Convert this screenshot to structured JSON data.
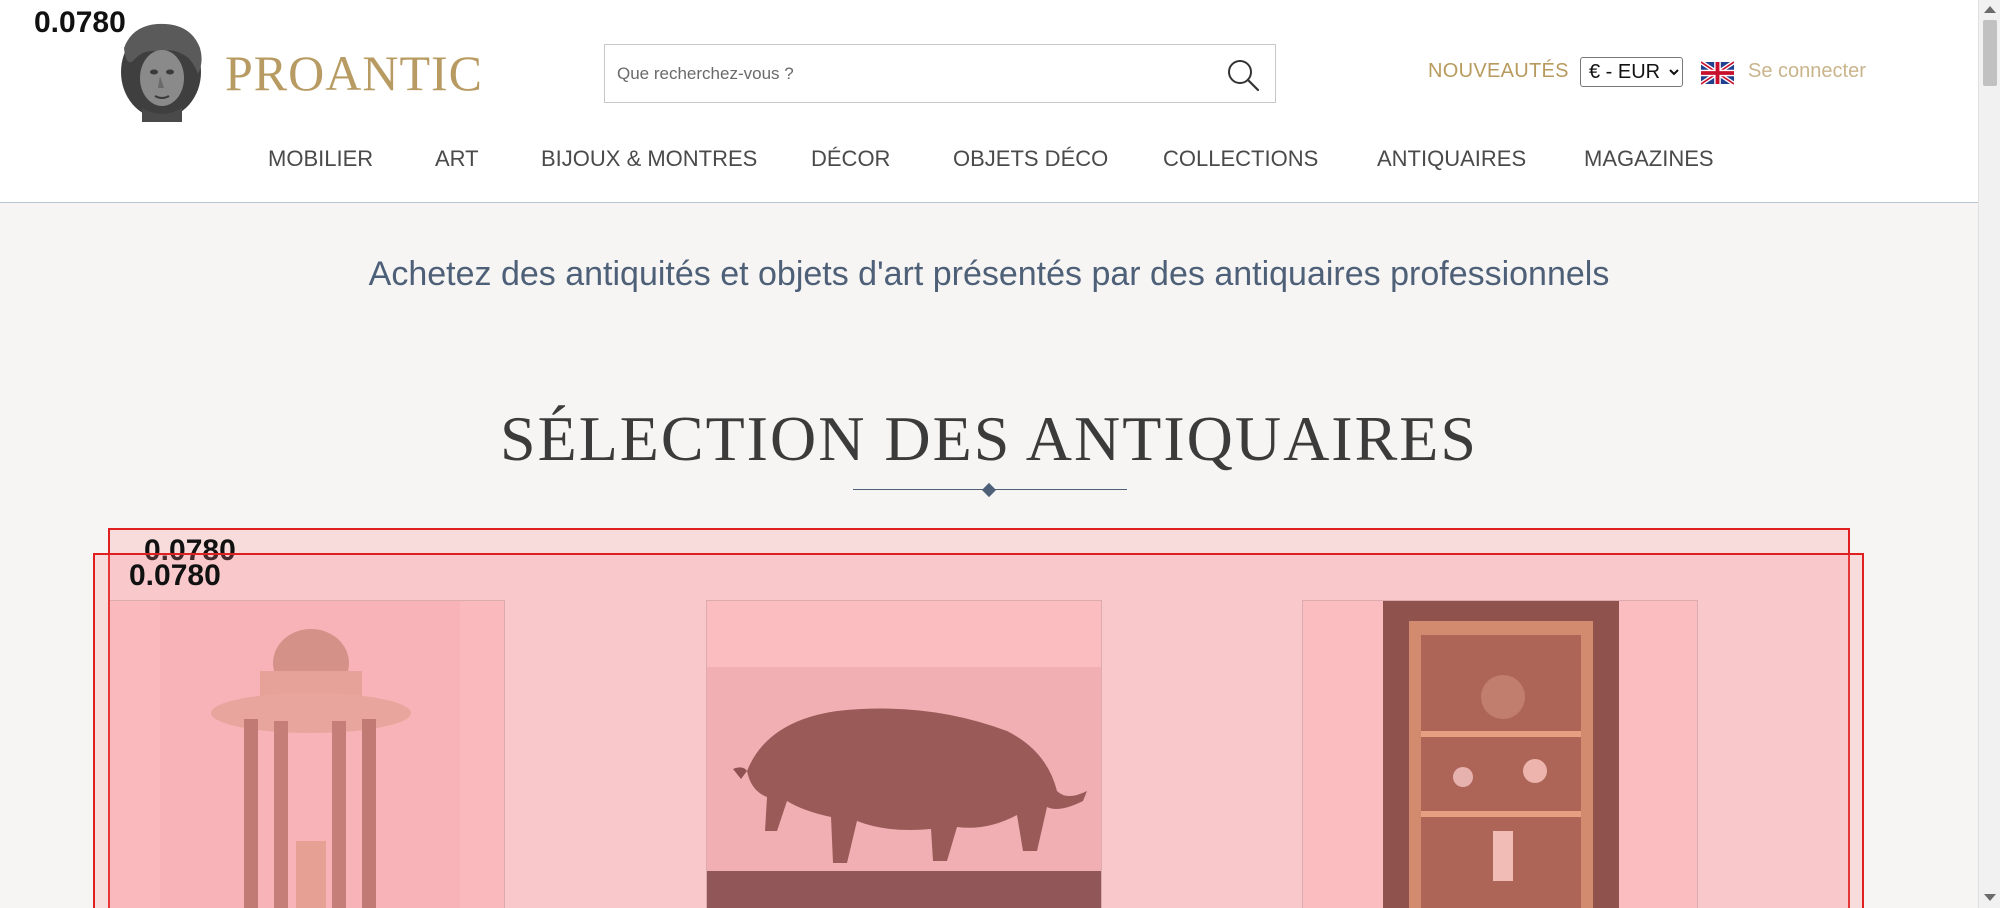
{
  "debug": {
    "score_top": "0.0780",
    "score_a": "0.0780",
    "score_b": "0.0780"
  },
  "brand": {
    "name": "PROANTIC",
    "logo_icon": "classical-bust-icon"
  },
  "search": {
    "placeholder": "Que recherchez-vous ?",
    "icon": "search-icon"
  },
  "topbar": {
    "new_label": "NOUVEAUTÉS",
    "currency_selected": "€ - EUR",
    "flag_icon": "uk-flag-icon",
    "login_label": "Se connecter"
  },
  "nav": {
    "items": [
      {
        "label": "MOBILIER"
      },
      {
        "label": "ART"
      },
      {
        "label": "BIJOUX & MONTRES"
      },
      {
        "label": "DÉCOR"
      },
      {
        "label": "OBJETS DÉCO"
      },
      {
        "label": "COLLECTIONS"
      },
      {
        "label": "ANTIQUAIRES"
      },
      {
        "label": "MAGAZINES"
      }
    ]
  },
  "main": {
    "tagline": "Achetez des antiquités et objets d'art présentés par des antiquaires professionnels",
    "section_title": "SÉLECTION DES ANTIQUAIRES"
  },
  "colors": {
    "brand_gold": "#b89b62",
    "accent_blue": "#4e6078",
    "overlay_red": "#e02020"
  }
}
